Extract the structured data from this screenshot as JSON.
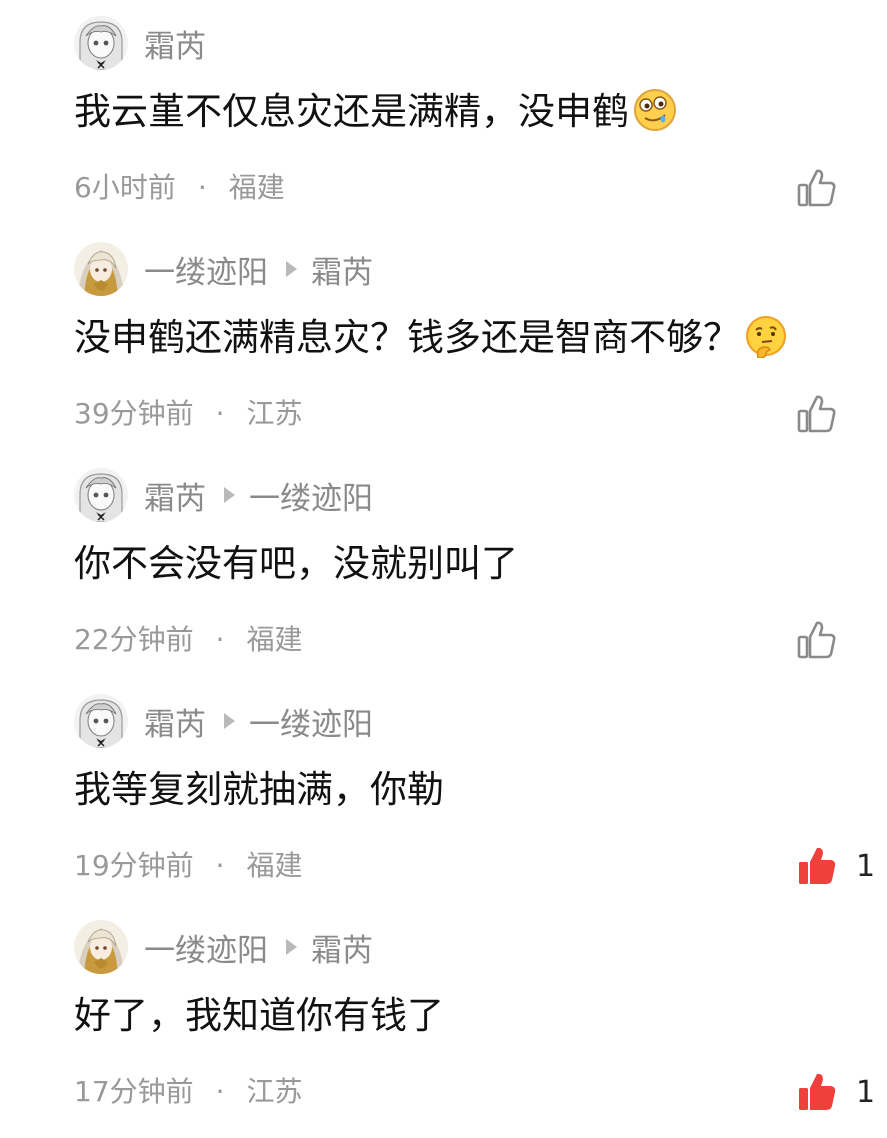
{
  "comments": [
    {
      "author": "霜芮",
      "reply_to": "",
      "text": "我云堇不仅息灾还是满精，没申鹤",
      "emoji": "drooling-face-emoji",
      "time": "6小时前",
      "location": "福建",
      "likes": "",
      "liked": false,
      "avatar": "white-hair-girl-avatar"
    },
    {
      "author": "一缕迹阳",
      "reply_to": "霜芮",
      "text": "没申鹤还满精息灾？钱多还是智商不够？",
      "emoji": "thinking-face-emoji",
      "time": "39分钟前",
      "location": "江苏",
      "likes": "",
      "liked": false,
      "avatar": "golden-hair-avatar"
    },
    {
      "author": "霜芮",
      "reply_to": "一缕迹阳",
      "text": "你不会没有吧，没就别叫了",
      "emoji": "",
      "time": "22分钟前",
      "location": "福建",
      "likes": "",
      "liked": false,
      "avatar": "white-hair-girl-avatar"
    },
    {
      "author": "霜芮",
      "reply_to": "一缕迹阳",
      "text": "我等复刻就抽满，你勒",
      "emoji": "",
      "time": "19分钟前",
      "location": "福建",
      "likes": "1",
      "liked": true,
      "avatar": "white-hair-girl-avatar"
    },
    {
      "author": "一缕迹阳",
      "reply_to": "霜芮",
      "text": "好了，我知道你有钱了",
      "emoji": "",
      "time": "17分钟前",
      "location": "江苏",
      "likes": "1",
      "liked": true,
      "avatar": "golden-hair-avatar"
    }
  ],
  "separator": "·",
  "colors": {
    "like_active": "#f0403c",
    "like_inactive": "#8a8a8a",
    "meta_text": "#999999",
    "name_text": "#8a8a8a"
  }
}
